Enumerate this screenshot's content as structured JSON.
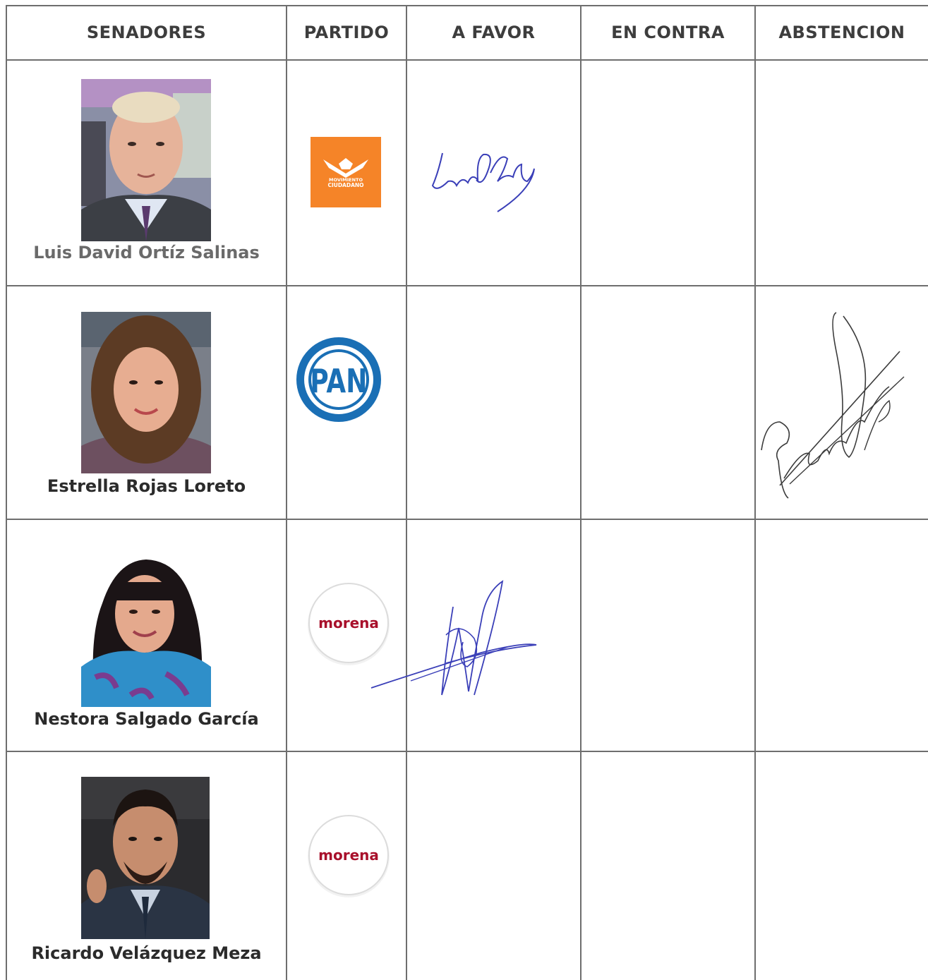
{
  "table": {
    "headers": {
      "senadores": "SENADORES",
      "partido": "PARTIDO",
      "a_favor": "A FAVOR",
      "en_contra": "EN CONTRA",
      "abstencion": "ABSTENCION"
    },
    "rows": [
      {
        "name": "Luis David Ortíz Salinas",
        "party_logo": "movimiento-ciudadano-logo",
        "party_logo_text": [
          "MOVIMIENTO",
          "CIUDADANO"
        ],
        "vote": "A FAVOR",
        "signature": "signature-luis-david-ortiz"
      },
      {
        "name": "Estrella Rojas Loreto",
        "party_logo": "pan-logo",
        "party_logo_text": [
          "PAN"
        ],
        "vote": "ABSTENCION",
        "signature": "signature-estrella-rojas"
      },
      {
        "name": "Nestora Salgado García",
        "party_logo": "morena-logo",
        "party_logo_text": [
          "morena"
        ],
        "vote": "A FAVOR",
        "signature": "signature-nestora-salgado"
      },
      {
        "name": "Ricardo Velázquez Meza",
        "party_logo": "morena-logo",
        "party_logo_text": [
          "morena"
        ],
        "vote": "",
        "signature": ""
      }
    ]
  },
  "colors": {
    "mc_orange": "#f58428",
    "pan_blue": "#1a6fb5",
    "morena_red": "#a8102b",
    "ink_blue": "#3a3fb8",
    "grid": "#6e6e6e"
  }
}
